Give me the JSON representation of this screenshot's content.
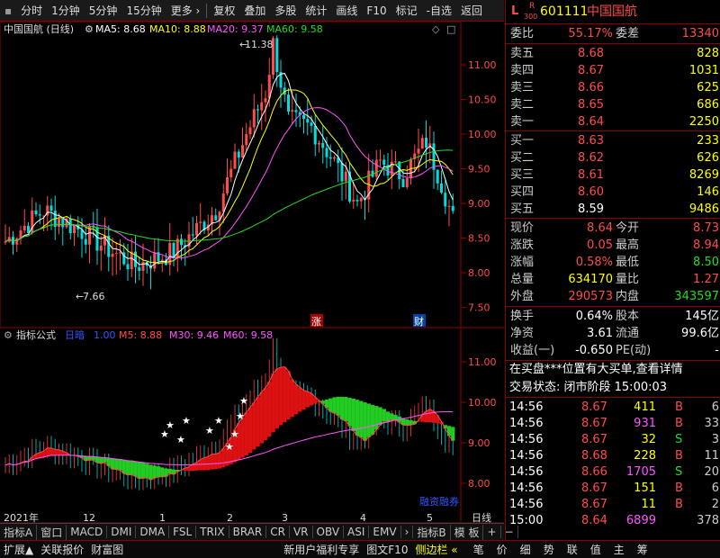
{
  "toolbar": {
    "items": [
      "分时",
      "1分钟",
      "5分钟",
      "15分钟",
      "更多 ›"
    ],
    "right": [
      "复权",
      "叠加",
      "多股",
      "统计",
      "画线",
      "F10",
      "标记",
      "-自选",
      "返回"
    ]
  },
  "main_chart": {
    "title": "中国国航 (日线)",
    "ma5": "MA5: 8.68",
    "ma10": "MA10: 8.88",
    "ma20": "MA20: 9.37",
    "ma60": "MA60: 9.58",
    "high_label": "11.38",
    "low_label": "7.66",
    "yticks": [
      "11.00",
      "10.50",
      "10.00",
      "9.50",
      "9.00",
      "8.50",
      "8.00",
      "7.50"
    ],
    "badge_zhang": "涨",
    "badge_cai": "财"
  },
  "sub_chart": {
    "title": "指标公式",
    "label": "日暗",
    "val1": "1.00",
    "m5": "M5: 8.88",
    "m30": "M30: 9.46",
    "m60": "M60: 9.58",
    "yticks": [
      "11.00",
      "10.00",
      "9.00",
      "8.00"
    ],
    "rzrq": "融资融券"
  },
  "xaxis": {
    "labels": [
      "2021年",
      "12",
      "1",
      "2",
      "3",
      "4",
      "5"
    ],
    "period": "日线"
  },
  "tabs": [
    "指标A",
    "窗口",
    "MACD",
    "DMI",
    "DMA",
    "FSL",
    "TRIX",
    "BRAR",
    "CR",
    "VR",
    "OBV",
    "ASI",
    "EMV",
    "›",
    "指标B",
    "模 板",
    "+",
    "−"
  ],
  "bottom": [
    "扩展▲",
    "关联报价",
    "财富图",
    "新用户福利专享",
    "图文F10",
    "侧边栏 «",
    "笔",
    "价",
    "细",
    "势",
    "联",
    "值",
    "主",
    "筹"
  ],
  "stock": {
    "flags": "L",
    "r": "R",
    "r300": "300",
    "code": "601111",
    "name": "中国国航"
  },
  "weibi": {
    "label": "委比",
    "value": "55.17%",
    "cha_label": "委差",
    "cha": "13340"
  },
  "sells": [
    {
      "l": "卖五",
      "p": "8.68",
      "v": "828"
    },
    {
      "l": "卖四",
      "p": "8.67",
      "v": "1031"
    },
    {
      "l": "卖三",
      "p": "8.66",
      "v": "625"
    },
    {
      "l": "卖二",
      "p": "8.65",
      "v": "686"
    },
    {
      "l": "卖一",
      "p": "8.64",
      "v": "2250"
    }
  ],
  "buys": [
    {
      "l": "买一",
      "p": "8.63",
      "v": "233"
    },
    {
      "l": "买二",
      "p": "8.62",
      "v": "626"
    },
    {
      "l": "买三",
      "p": "8.61",
      "v": "8269"
    },
    {
      "l": "买四",
      "p": "8.60",
      "v": "146"
    },
    {
      "l": "买五",
      "p": "8.59",
      "v": "9486"
    }
  ],
  "quote": [
    {
      "a": "现价",
      "av": "8.64",
      "b": "今开",
      "bv": "8.73"
    },
    {
      "a": "涨跌",
      "av": "0.05",
      "b": "最高",
      "bv": "8.94"
    },
    {
      "a": "涨幅",
      "av": "0.58%",
      "b": "最低",
      "bv": "8.50"
    },
    {
      "a": "总量",
      "av": "634170",
      "b": "量比",
      "bv": "1.27"
    },
    {
      "a": "外盘",
      "av": "290573",
      "b": "内盘",
      "bv": "343597"
    }
  ],
  "quote2": [
    {
      "a": "换手",
      "av": "0.64%",
      "b": "股本",
      "bv": "145亿"
    },
    {
      "a": "净资",
      "av": "3.61",
      "b": "流通",
      "bv": "99.6亿"
    },
    {
      "a": "收益(一)",
      "av": "-0.650",
      "b": "PE(动)",
      "bv": "-"
    }
  ],
  "notice": "在买盘***位置有大买单,查看详情",
  "status": "交易状态: 闭市阶段  15:00:03",
  "trades": [
    {
      "t": "14:56",
      "p": "8.67",
      "v": "411",
      "d": "B",
      "n": "6"
    },
    {
      "t": "14:56",
      "p": "8.67",
      "v": "931",
      "d": "B",
      "n": "33"
    },
    {
      "t": "14:56",
      "p": "8.67",
      "v": "32",
      "d": "S",
      "n": "3"
    },
    {
      "t": "14:56",
      "p": "8.68",
      "v": "228",
      "d": "B",
      "n": "11"
    },
    {
      "t": "14:56",
      "p": "8.66",
      "v": "1705",
      "d": "S",
      "n": "20"
    },
    {
      "t": "14:56",
      "p": "8.67",
      "v": "151",
      "d": "B",
      "n": "6"
    },
    {
      "t": "14:56",
      "p": "8.67",
      "v": "11",
      "d": "B",
      "n": "2"
    },
    {
      "t": "15:00",
      "p": "8.64",
      "v": "6899",
      "d": "",
      "n": "378"
    }
  ]
}
